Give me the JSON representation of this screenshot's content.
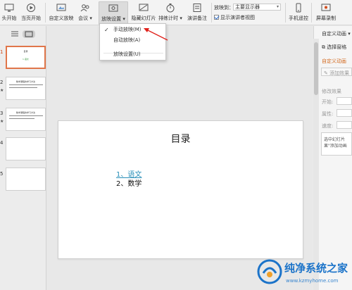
{
  "ribbon": {
    "buttons": [
      {
        "label": "头开始",
        "icon": "monitor-icon"
      },
      {
        "label": "当页开始",
        "icon": "play-icon"
      },
      {
        "label": "自定义放映",
        "icon": "custom-show-icon"
      },
      {
        "label": "会议",
        "icon": "meeting-icon"
      },
      {
        "label": "放映设置",
        "icon": "slideshow-settings-icon"
      },
      {
        "label": "隐藏幻灯片",
        "icon": "hide-slide-icon"
      },
      {
        "label": "排练计时",
        "icon": "timer-icon"
      },
      {
        "label": "演讲备注",
        "icon": "notes-icon"
      },
      {
        "label": "手机遥控",
        "icon": "phone-icon"
      },
      {
        "label": "屏幕录制",
        "icon": "screen-record-icon"
      }
    ],
    "play_to_label": "放映到：",
    "play_to_value": "主要显示器",
    "presenter_view_label": "显示演讲者视图"
  },
  "dropdown": {
    "items": [
      "手动放映(M)",
      "自动放映(A)",
      "放映设置(U)"
    ]
  },
  "slides": [
    {
      "number": "1",
      "title": "目录",
      "subtitle": "1.语文"
    },
    {
      "number": "2",
      "title": "数学课程的学习方法"
    },
    {
      "number": "3",
      "title": "数学课程的学习方法"
    },
    {
      "number": "4"
    },
    {
      "number": "5"
    }
  ],
  "canvas": {
    "title": "目录",
    "item1": "1、语文",
    "item2": "2、数学"
  },
  "right_panel": {
    "header": "自定义动画",
    "select_pane": "选择窗格",
    "custom_anim": "自定义动画",
    "add_effect": "添加效果",
    "modify_effect": "修改效果",
    "start_label": "开始:",
    "property_label": "属性:",
    "speed_label": "速度:",
    "hint_line1": "选中幻灯片",
    "hint_line2": "果\"添加动画"
  },
  "watermark": {
    "text": "纯净系统之家",
    "url": "www.kzmyhome.com"
  },
  "colors": {
    "accent_orange": "#e0764a",
    "link_teal": "#2a8fb8",
    "watermark_blue": "#1b73c9"
  }
}
